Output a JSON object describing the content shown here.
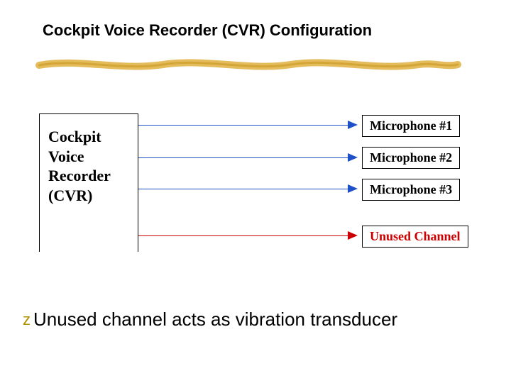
{
  "title": "Cockpit Voice Recorder (CVR) Configuration",
  "colors": {
    "brush": "#e0b040",
    "blue": "#1e50c8",
    "red": "#cc0000",
    "bullet": "#b09000"
  },
  "cvr_box": {
    "lines": [
      "Cockpit",
      "Voice",
      "Recorder",
      "(CVR)"
    ]
  },
  "channels": [
    {
      "label": "Microphone #1",
      "type": "mic"
    },
    {
      "label": "Microphone #2",
      "type": "mic"
    },
    {
      "label": "Microphone #3",
      "type": "mic"
    },
    {
      "label": "Unused Channel",
      "type": "unused"
    }
  ],
  "bullet": {
    "glyph": "z",
    "text": "Unused channel acts as vibration transducer"
  },
  "chart_data": {
    "type": "diagram",
    "title": "Cockpit Voice Recorder (CVR) Configuration",
    "source_node": "Cockpit Voice Recorder (CVR)",
    "edges": [
      {
        "from": "CVR",
        "to": "Microphone #1",
        "color": "blue"
      },
      {
        "from": "CVR",
        "to": "Microphone #2",
        "color": "blue"
      },
      {
        "from": "CVR",
        "to": "Microphone #3",
        "color": "blue"
      },
      {
        "from": "CVR",
        "to": "Unused Channel",
        "color": "red"
      }
    ],
    "note": "Unused channel acts as vibration transducer"
  }
}
